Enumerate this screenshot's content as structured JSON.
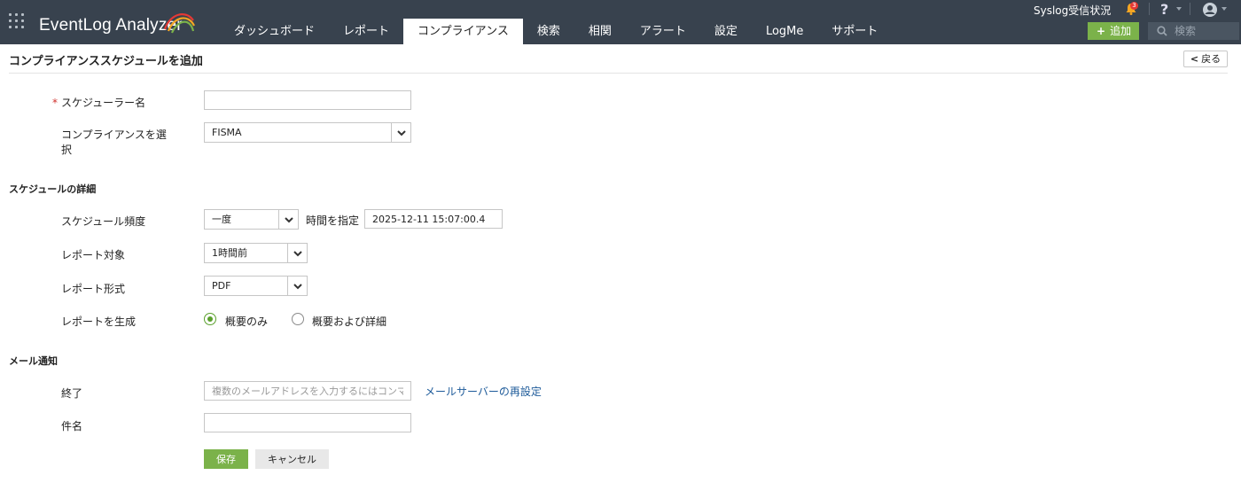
{
  "app": {
    "brand": "EventLog Analyzer"
  },
  "nav": {
    "tabs": [
      {
        "label": "ダッシュボード"
      },
      {
        "label": "レポート"
      },
      {
        "label": "コンプライアンス",
        "active": true
      },
      {
        "label": "検索"
      },
      {
        "label": "相関"
      },
      {
        "label": "アラート"
      },
      {
        "label": "設定"
      },
      {
        "label": "LogMe"
      },
      {
        "label": "サポート"
      }
    ]
  },
  "topright": {
    "syslog_status": "Syslog受信状況",
    "notification_count": "3",
    "help_symbol": "?",
    "add_label": "追加",
    "add_symbol": "+",
    "search_placeholder": "検索"
  },
  "page": {
    "title": "コンプライアンススケジュールを追加",
    "back_label": "戻る",
    "back_symbol": "<"
  },
  "form": {
    "required_mark": "*",
    "scheduler_name_label": "スケジューラー名",
    "scheduler_name_value": "",
    "compliance_label_line1": "コンプライアンスを選",
    "compliance_label_line2": "択",
    "compliance_value": "FISMA",
    "schedule_section": "スケジュールの詳細",
    "frequency_label": "スケジュール頻度",
    "frequency_value": "一度",
    "time_label": "時間を指定",
    "time_value": "2025-12-11 15:07:00.4",
    "report_target_label": "レポート対象",
    "report_target_value": "1時間前",
    "report_format_label": "レポート形式",
    "report_format_value": "PDF",
    "generate_label": "レポートを生成",
    "generate_options": [
      {
        "label": "概要のみ",
        "checked": true
      },
      {
        "label": "概要および詳細",
        "checked": false
      }
    ],
    "mail_section": "メール通知",
    "to_label": "終了",
    "to_placeholder": "複数のメールアドレスを入力するにはコンマ",
    "mail_server_link": "メールサーバーの再設定",
    "subject_label": "件名",
    "subject_value": "",
    "save_label": "保存",
    "cancel_label": "キャンセル"
  },
  "colors": {
    "topbar": "#38424e",
    "accent_green": "#7bb24a",
    "link": "#1e5b9a",
    "required": "#d0312d"
  },
  "icons": [
    "apps-grid-icon",
    "logo-swoosh-icon",
    "bell-icon",
    "help-icon",
    "user-icon",
    "search-icon",
    "chevron-left-icon",
    "chevron-down-icon"
  ]
}
